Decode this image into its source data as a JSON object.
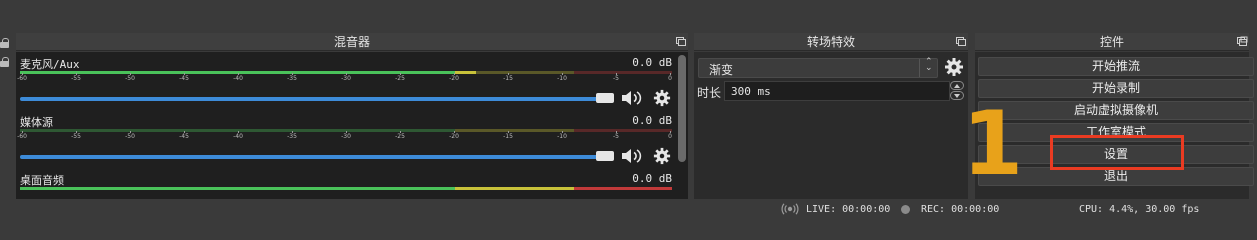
{
  "docks": {
    "mixer": {
      "title": "混音器"
    },
    "transition": {
      "title": "转场特效"
    },
    "controls": {
      "title": "控件"
    }
  },
  "mixer": {
    "channels": [
      {
        "name": "麦克风/Aux",
        "db": "0.0 dB",
        "level": 0.7
      },
      {
        "name": "媒体源",
        "db": "0.0 dB",
        "level": 0.0
      },
      {
        "name": "桌面音频",
        "db": "0.0 dB",
        "level": 1.0
      }
    ],
    "ticks": [
      "-60",
      "-55",
      "-50",
      "-45",
      "-40",
      "-35",
      "-30",
      "-25",
      "-20",
      "-15",
      "-10",
      "-5",
      "0"
    ],
    "colors": {
      "green": "#4ac25a",
      "yellow": "#c8c23a",
      "red": "#c23a3a",
      "fader": "#3d8bd8"
    }
  },
  "transition": {
    "selected": "渐变",
    "duration_label": "时长",
    "duration_value": "300 ms"
  },
  "controls": {
    "buttons": [
      "开始推流",
      "开始录制",
      "启动虚拟摄像机",
      "工作室模式",
      "设置",
      "退出"
    ]
  },
  "annotation": {
    "number": "1",
    "color": "#e8a21a",
    "box_color": "#ea3b22"
  },
  "status": {
    "live": "LIVE: 00:00:00",
    "rec": "REC: 00:00:00",
    "cpu": "CPU: 4.4%, 30.00 fps"
  }
}
